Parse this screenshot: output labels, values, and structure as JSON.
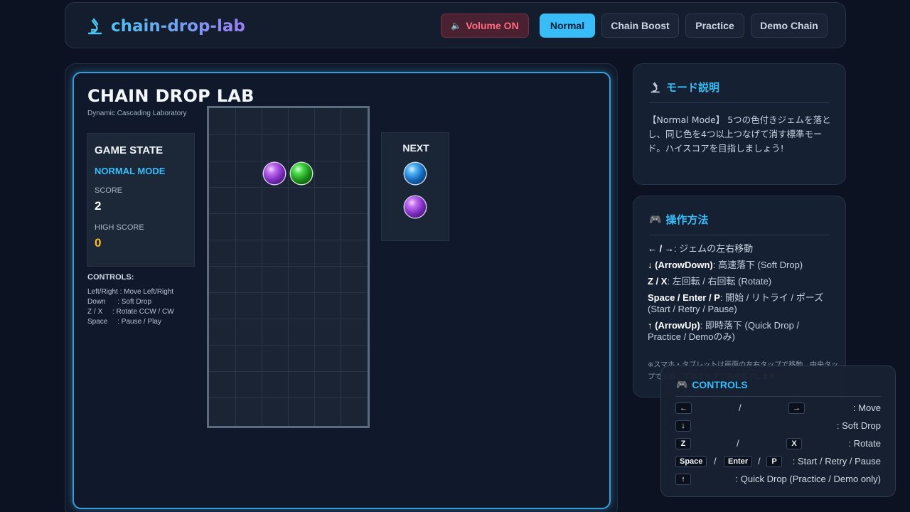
{
  "header": {
    "logo": "chain-drop-lab",
    "buttons": {
      "volume": "Volume ON",
      "normal": "Normal",
      "chain_boost": "Chain Boost",
      "practice": "Practice",
      "demo_chain": "Demo Chain"
    },
    "colors": {
      "accent": "#38bdf8",
      "volume": "#ff6b81"
    }
  },
  "game": {
    "title": "CHAIN DROP LAB",
    "subtitle": "Dynamic Cascading Laboratory",
    "state": {
      "heading": "GAME STATE",
      "mode": "NORMAL MODE",
      "score_label": "SCORE",
      "score": "2",
      "high_score_label": "HIGH SCORE",
      "high_score": "0"
    },
    "controls": {
      "heading": "CONTROLS:",
      "lines": [
        "Left/Right : Move Left/Right",
        "Down      : Soft Drop",
        "Z / X     : Rotate CCW / CW",
        "Space     : Pause / Play"
      ]
    },
    "board": {
      "columns": 6,
      "rows": 12,
      "pieces": [
        {
          "color": "purple",
          "col": 2,
          "row": 2
        },
        {
          "color": "green",
          "col": 3,
          "row": 2
        }
      ]
    },
    "next": {
      "heading": "NEXT",
      "gems": [
        "blue",
        "purple"
      ]
    }
  },
  "mode_panel": {
    "title": "モード説明",
    "body": "【Normal Mode】 5つの色付きジェムを落とし、同じ色を4つ以上つなげて消す標準モード。ハイスコアを目指しましょう!"
  },
  "ops_panel": {
    "title": "操作方法",
    "items": [
      {
        "key": "← / →",
        "desc": ": ジェムの左右移動"
      },
      {
        "key": "↓ (ArrowDown)",
        "desc": ": 高速落下 (Soft Drop)"
      },
      {
        "key": "Z / X",
        "desc": ": 左回転 / 右回転 (Rotate)"
      },
      {
        "key": "Space / Enter / P",
        "desc": ": 開始 / リトライ / ポーズ (Start / Retry / Pause)"
      },
      {
        "key": "↑ (ArrowUp)",
        "desc": ": 即時落下 (Quick Drop / Practice / Demoのみ)"
      }
    ],
    "note": "※スマホ・タブレットは画面の左右タップで移動、中央タップで回転、下部タップで高速落下します。"
  },
  "overlay": {
    "title": "CONTROLS",
    "rows": [
      {
        "keys": [
          "←",
          "→"
        ],
        "seps": [
          "/"
        ],
        "label": ": Move"
      },
      {
        "keys": [
          "↓"
        ],
        "seps": [],
        "label": ": Soft Drop"
      },
      {
        "keys": [
          "Z",
          "X"
        ],
        "seps": [
          "/"
        ],
        "label": ": Rotate"
      },
      {
        "keys": [
          "Space",
          "Enter",
          "P"
        ],
        "seps": [
          "/",
          "/"
        ],
        "label": ": Start / Retry / Pause"
      },
      {
        "keys": [
          "↑"
        ],
        "seps": [],
        "label": ": Quick Drop (Practice / Demo only)"
      }
    ]
  }
}
